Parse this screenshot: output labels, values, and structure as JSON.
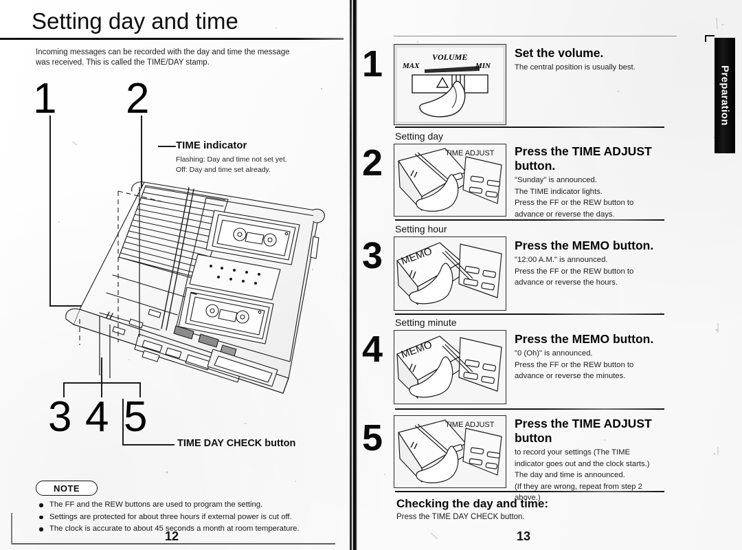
{
  "document": {
    "left_page": {
      "title": "Setting day and time",
      "intro": "Incoming messages can be recorded with the day and time the message was received. This is called the TIME/DAY stamp.",
      "callout_numbers": [
        "1",
        "2",
        "3",
        "4",
        "5"
      ],
      "labels": {
        "time_indicator": "TIME indicator",
        "time_indicator_flashing": "Flashing:  Day and time not set yet.",
        "time_indicator_off": "Off:  Day and time set already.",
        "time_day_check": "TIME DAY CHECK button"
      },
      "note": {
        "badge": "NOTE",
        "items": [
          "The FF and the REW buttons are used to program the setting.",
          "Settings are protected for about three hours if external power is cut off.",
          "The clock is accurate to about 45 seconds a month at room temperature."
        ]
      },
      "page_number": "12"
    },
    "right_page": {
      "side_tab": "Preparation",
      "steps": [
        {
          "number": "1",
          "section": "",
          "title": "Set the volume.",
          "body": "The central position is usually best.",
          "thumb": {
            "name": "volume-slider-photo",
            "labels": [
              "VOLUME",
              "MAX",
              "MIN"
            ]
          }
        },
        {
          "number": "2",
          "section": "Setting day",
          "title": "Press the TIME ADJUST button.",
          "body": "\"Sunday\" is announced.\nThe TIME indicator lights.\nPress the FF or the REW button to\nadvance or reverse the days.",
          "thumb": {
            "name": "time-adjust-button-photo",
            "labels": [
              "TIME ADJUST"
            ]
          }
        },
        {
          "number": "3",
          "section": "Setting hour",
          "title": "Press the MEMO button.",
          "body": "\"12:00 A.M.\" is announced.\nPress the FF or the REW button to\nadvance or reverse the hours.",
          "thumb": {
            "name": "memo-button-photo",
            "labels": [
              "MEMO"
            ]
          }
        },
        {
          "number": "4",
          "section": "Setting minute",
          "title": "Press the MEMO button.",
          "body": "\"0 (Oh)\" is announced.\nPress the FF or the REW button to\nadvance  or reverse the minutes.",
          "thumb": {
            "name": "memo-button-photo",
            "labels": [
              "MEMO"
            ]
          }
        },
        {
          "number": "5",
          "section": "",
          "title": "Press the TIME ADJUST button",
          "body": "to record your settings (The TIME\nindicator goes out and the clock starts.)\nThe day and time is announced.\n(If they are wrong, repeat from step 2\nabove.)",
          "thumb": {
            "name": "time-adjust-button-photo",
            "labels": [
              "TIME ADJUST"
            ]
          }
        }
      ],
      "checking": {
        "title": "Checking the day and time:",
        "body": "Press the TIME DAY CHECK button."
      },
      "page_number": "13"
    }
  },
  "colors": {
    "ink": "#111111",
    "paper": "#fdfdfc",
    "tab_background": "#000000",
    "tab_text": "#ffffff"
  }
}
